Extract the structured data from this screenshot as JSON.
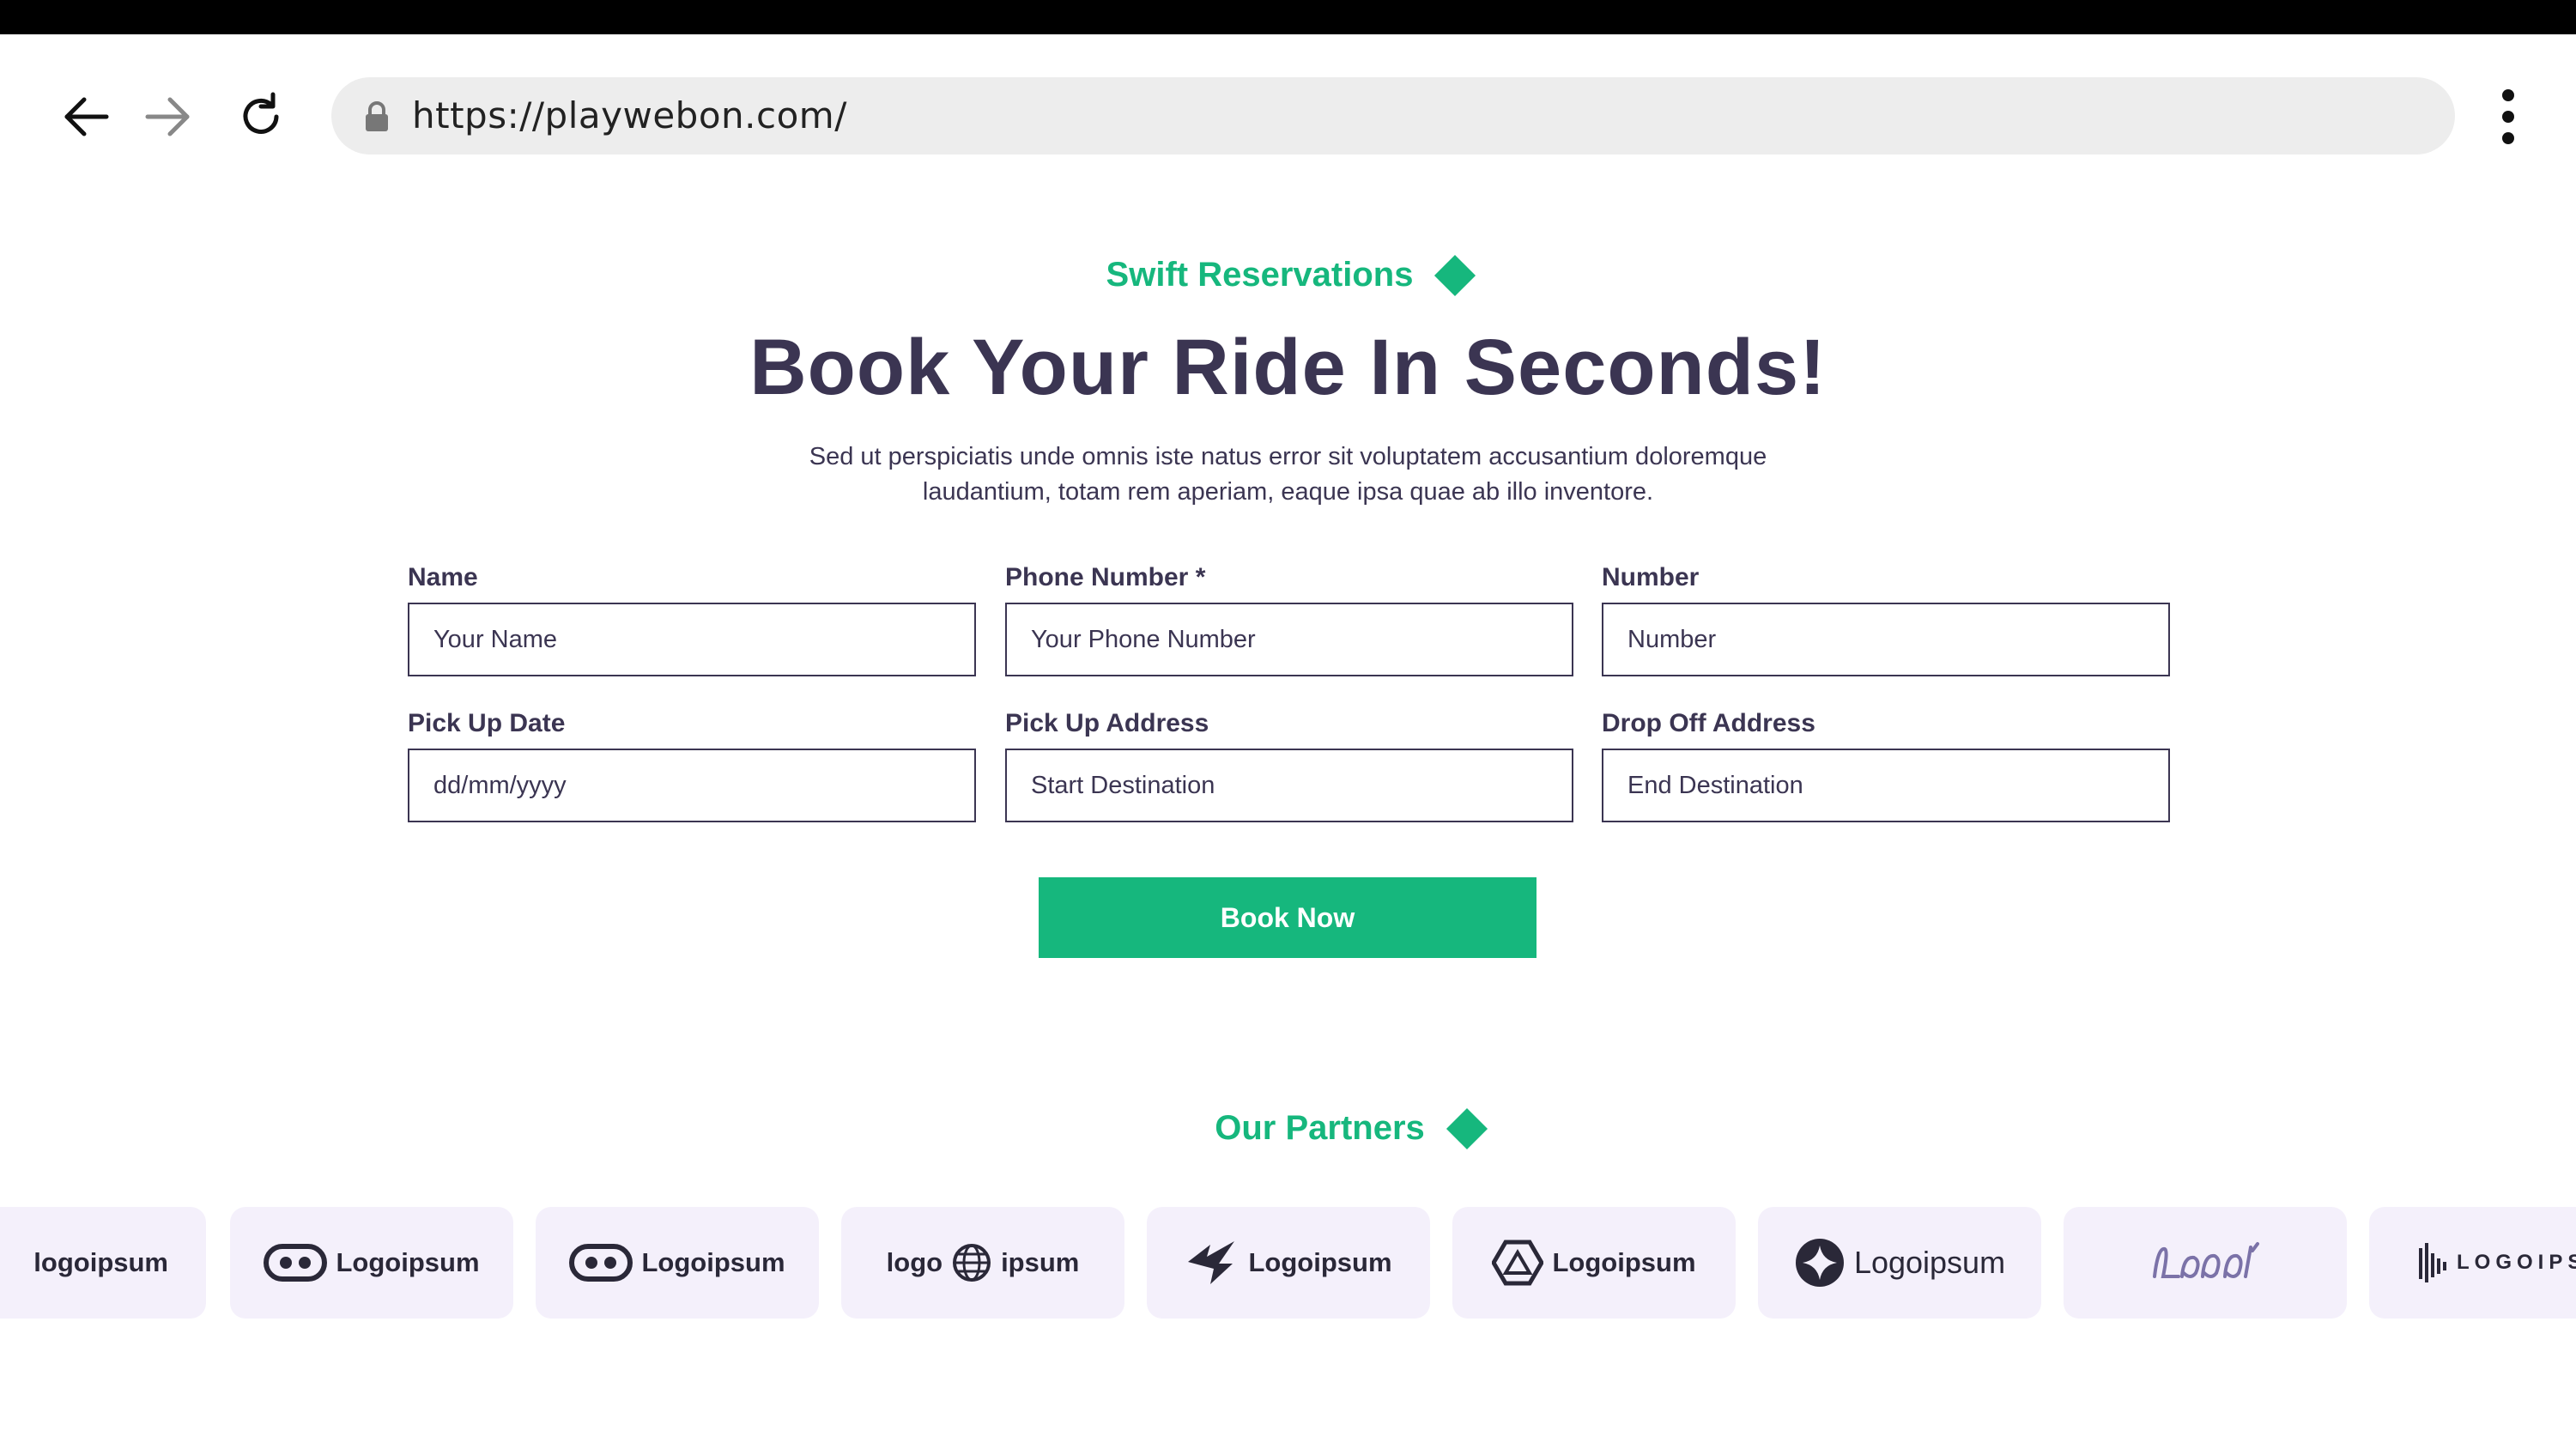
{
  "browser": {
    "url": "https://playwebon.com/"
  },
  "hero": {
    "eyebrow": "Swift Reservations",
    "title": "Book Your Ride In Seconds!",
    "subtitle_line1": "Sed ut perspiciatis unde omnis iste natus error sit voluptatem accusantium doloremque",
    "subtitle_line2": "laudantium, totam rem aperiam, eaque ipsa quae ab illo inventore."
  },
  "form": {
    "fields": [
      {
        "label": "Name",
        "placeholder": "Your Name"
      },
      {
        "label": "Phone Number *",
        "placeholder": "Your Phone Number"
      },
      {
        "label": "Number",
        "placeholder": "Number"
      },
      {
        "label": "Pick Up Date",
        "placeholder": "dd/mm/yyyy"
      },
      {
        "label": "Pick Up Address",
        "placeholder": "Start Destination"
      },
      {
        "label": "Drop Off Address",
        "placeholder": "End Destination"
      }
    ],
    "submit_label": "Book Now"
  },
  "partners": {
    "title": "Our Partners",
    "logos": [
      {
        "text": "logoipsum",
        "icon": "logoipsum-partial-logo"
      },
      {
        "text": "Logoipsum",
        "icon": "pill-eyes-logo"
      },
      {
        "text": "Logoipsum",
        "icon": "pill-eyes-logo"
      },
      {
        "text": "logo",
        "text2": "ipsum",
        "icon": "globe-logo"
      },
      {
        "text": "Logoipsum",
        "icon": "bird-logo"
      },
      {
        "text": "Logoipsum",
        "icon": "hexagon-logo"
      },
      {
        "text": "Logoipsum",
        "icon": "star-circle-logo"
      },
      {
        "text": "",
        "icon": "script-logo"
      },
      {
        "text": "LOGOIPSU",
        "icon": "sound-bars-logo"
      }
    ]
  },
  "colors": {
    "accent": "#16b77d",
    "heading": "#3b3552",
    "logo_card_bg": "#f4f0fb"
  }
}
